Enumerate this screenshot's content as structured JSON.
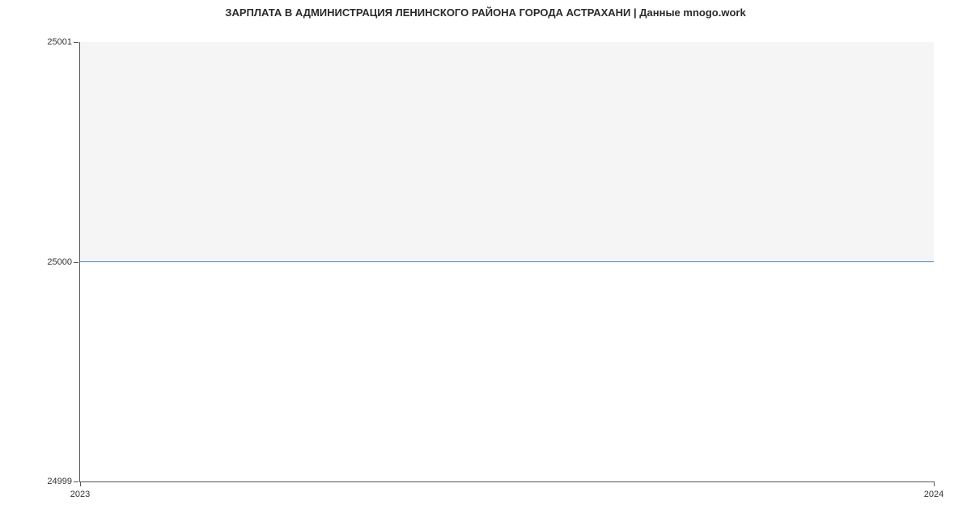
{
  "chart_data": {
    "type": "area",
    "title": "ЗАРПЛАТА В АДМИНИСТРАЦИЯ ЛЕНИНСКОГО РАЙОНА ГОРОДА АСТРАХАНИ | Данные mnogo.work",
    "x": [
      2023,
      2024
    ],
    "values": [
      25000,
      25000
    ],
    "xlabel": "",
    "ylabel": "",
    "ylim": [
      24999,
      25001
    ],
    "y_ticks": [
      24999,
      25000,
      25001
    ],
    "x_ticks": [
      2023,
      2024
    ],
    "line_color": "#4a7fc8",
    "fill_color": "#f5f5f5"
  }
}
